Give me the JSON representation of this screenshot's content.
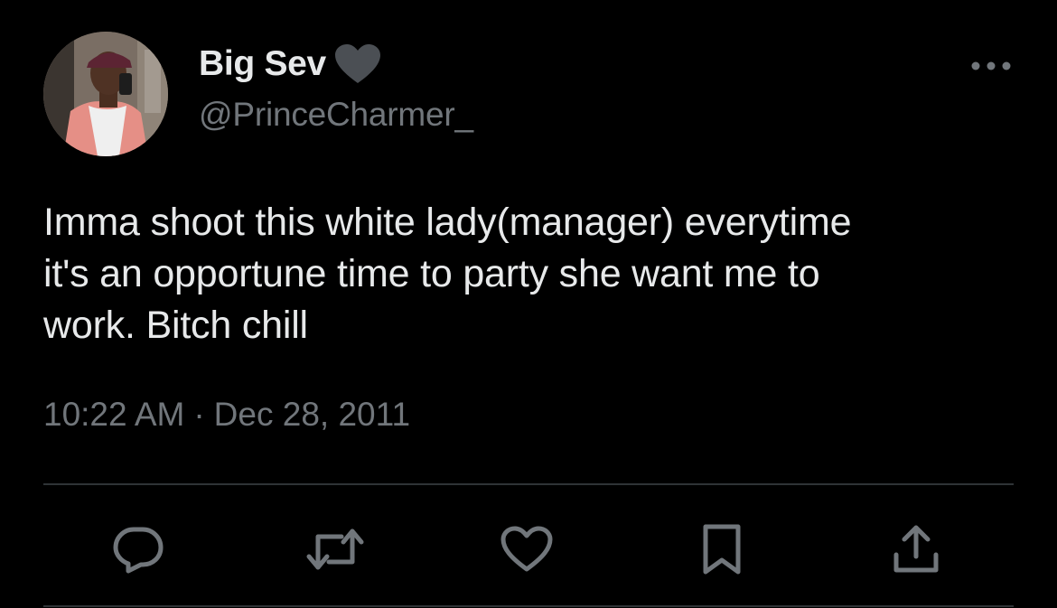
{
  "author": {
    "display_name": "Big Sev",
    "handle": "@PrinceCharmer_",
    "badge_icon": "heart-icon",
    "avatar_icon": "profile-photo"
  },
  "tweet": {
    "text": "Imma shoot this white lady(manager) everytime\nit's an opportune time to party she want me to\nwork. Bitch chill",
    "time": "10:22 AM",
    "separator": "·",
    "date": "Dec 28, 2011"
  },
  "actions": {
    "reply_icon": "reply-icon",
    "retweet_icon": "retweet-icon",
    "like_icon": "like-icon",
    "bookmark_icon": "bookmark-icon",
    "share_icon": "share-icon"
  },
  "colors": {
    "background": "#000000",
    "primary_text": "#e7e9ea",
    "secondary_text": "#71767b",
    "divider": "#2f3336"
  }
}
